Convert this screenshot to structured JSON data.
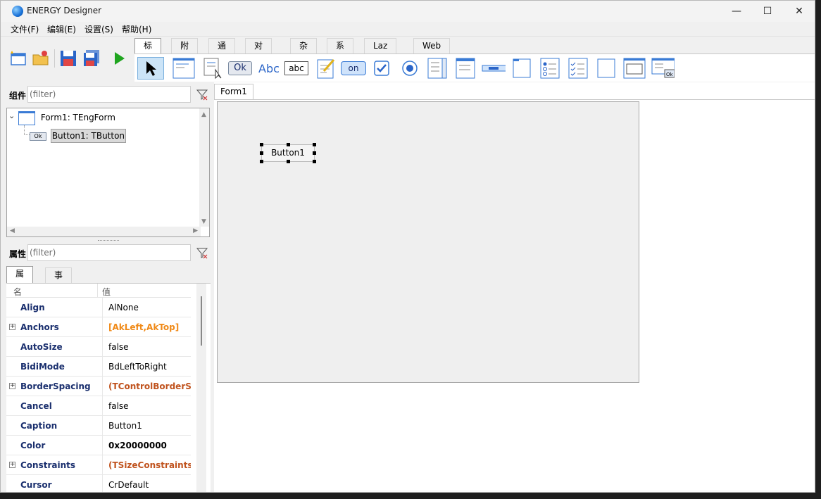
{
  "window": {
    "title": "ENERGY Designer",
    "minimize": "—",
    "maximize": "☐",
    "close": "✕"
  },
  "menu": [
    "文件(F)",
    "编辑(E)",
    "设置(S)",
    "帮助(H)"
  ],
  "palette_tabs": [
    "标准",
    "附加",
    "通用",
    "对话框",
    "杂项",
    "系统",
    "Laz组件",
    "Web"
  ],
  "palette_icons": {
    "ok": "Ok",
    "abc_label": "Abc",
    "abc_edit": "abc",
    "on": "on"
  },
  "components": {
    "label": "组件",
    "filter_placeholder": "(filter)",
    "tree": [
      {
        "label": "Form1: TEngForm",
        "icon": "form-icon"
      },
      {
        "label": "Button1: TButton",
        "icon": "button-icon",
        "icon_text": "Ok",
        "selected": true
      }
    ]
  },
  "properties": {
    "label": "属性",
    "filter_placeholder": "(filter)",
    "tabs": [
      "属性",
      "事件"
    ],
    "head_name": "名",
    "head_value": "值",
    "rows": [
      {
        "name": "Align",
        "value": "AlNone",
        "expandable": false,
        "style": "normal"
      },
      {
        "name": "Anchors",
        "value": "[AkLeft,AkTop]",
        "expandable": true,
        "style": "orange"
      },
      {
        "name": "AutoSize",
        "value": "false",
        "expandable": false,
        "style": "normal"
      },
      {
        "name": "BidiMode",
        "value": "BdLeftToRight",
        "expandable": false,
        "style": "normal"
      },
      {
        "name": "BorderSpacing",
        "value": "(TControlBorderS…",
        "expandable": true,
        "style": "rust"
      },
      {
        "name": "Cancel",
        "value": "false",
        "expandable": false,
        "style": "normal"
      },
      {
        "name": "Caption",
        "value": "Button1",
        "expandable": false,
        "style": "normal"
      },
      {
        "name": "Color",
        "value": "0x20000000",
        "expandable": false,
        "style": "bold"
      },
      {
        "name": "Constraints",
        "value": "(TSizeConstraints)",
        "expandable": true,
        "style": "rust"
      },
      {
        "name": "Cursor",
        "value": "CrDefault",
        "expandable": false,
        "style": "normal"
      }
    ]
  },
  "designer": {
    "tab": "Form1",
    "button_caption": "Button1"
  },
  "colors": {
    "orange": "#f08a18",
    "rust": "#c0531e",
    "name": "#1a2f6e",
    "accent": "#1a73d9"
  }
}
